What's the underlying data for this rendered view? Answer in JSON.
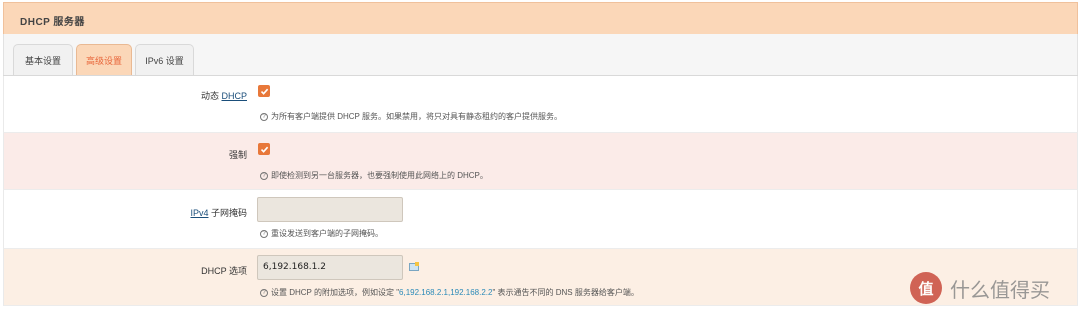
{
  "panel": {
    "title": "DHCP 服务器"
  },
  "tabs": [
    {
      "label": "基本设置",
      "active": false
    },
    {
      "label": "高级设置",
      "active": true
    },
    {
      "label": "IPv6 设置",
      "active": false
    }
  ],
  "fields": {
    "dynamic_dhcp": {
      "label_prefix": "动态 ",
      "label_link": "DHCP",
      "checked": true,
      "help": "为所有客户端提供 DHCP 服务。如果禁用，将只对具有静态租约的客户提供服务。"
    },
    "force": {
      "label": "强制",
      "checked": true,
      "help": "即使检测到另一台服务器，也要强制使用此网络上的 DHCP。"
    },
    "ipv4_netmask": {
      "label_link": "IPv4",
      "label_suffix": " 子网掩码",
      "value": "",
      "help": "重设发送到客户端的子网掩码。"
    },
    "dhcp_options": {
      "label": "DHCP 选项",
      "value": "6,192.168.1.2",
      "help_prefix": "设置 DHCP 的附加选项，例如设定 \"",
      "help_example": "6,192.168.2.1,192.168.2.2",
      "help_suffix": "\" 表示通告不同的 DNS 服务器给客户端。"
    }
  },
  "watermark": {
    "badge": "值",
    "text": "什么值得买"
  },
  "colors": {
    "accent": "#e8783a",
    "header": "#fbd7b8",
    "link": "#1a4e7a"
  }
}
